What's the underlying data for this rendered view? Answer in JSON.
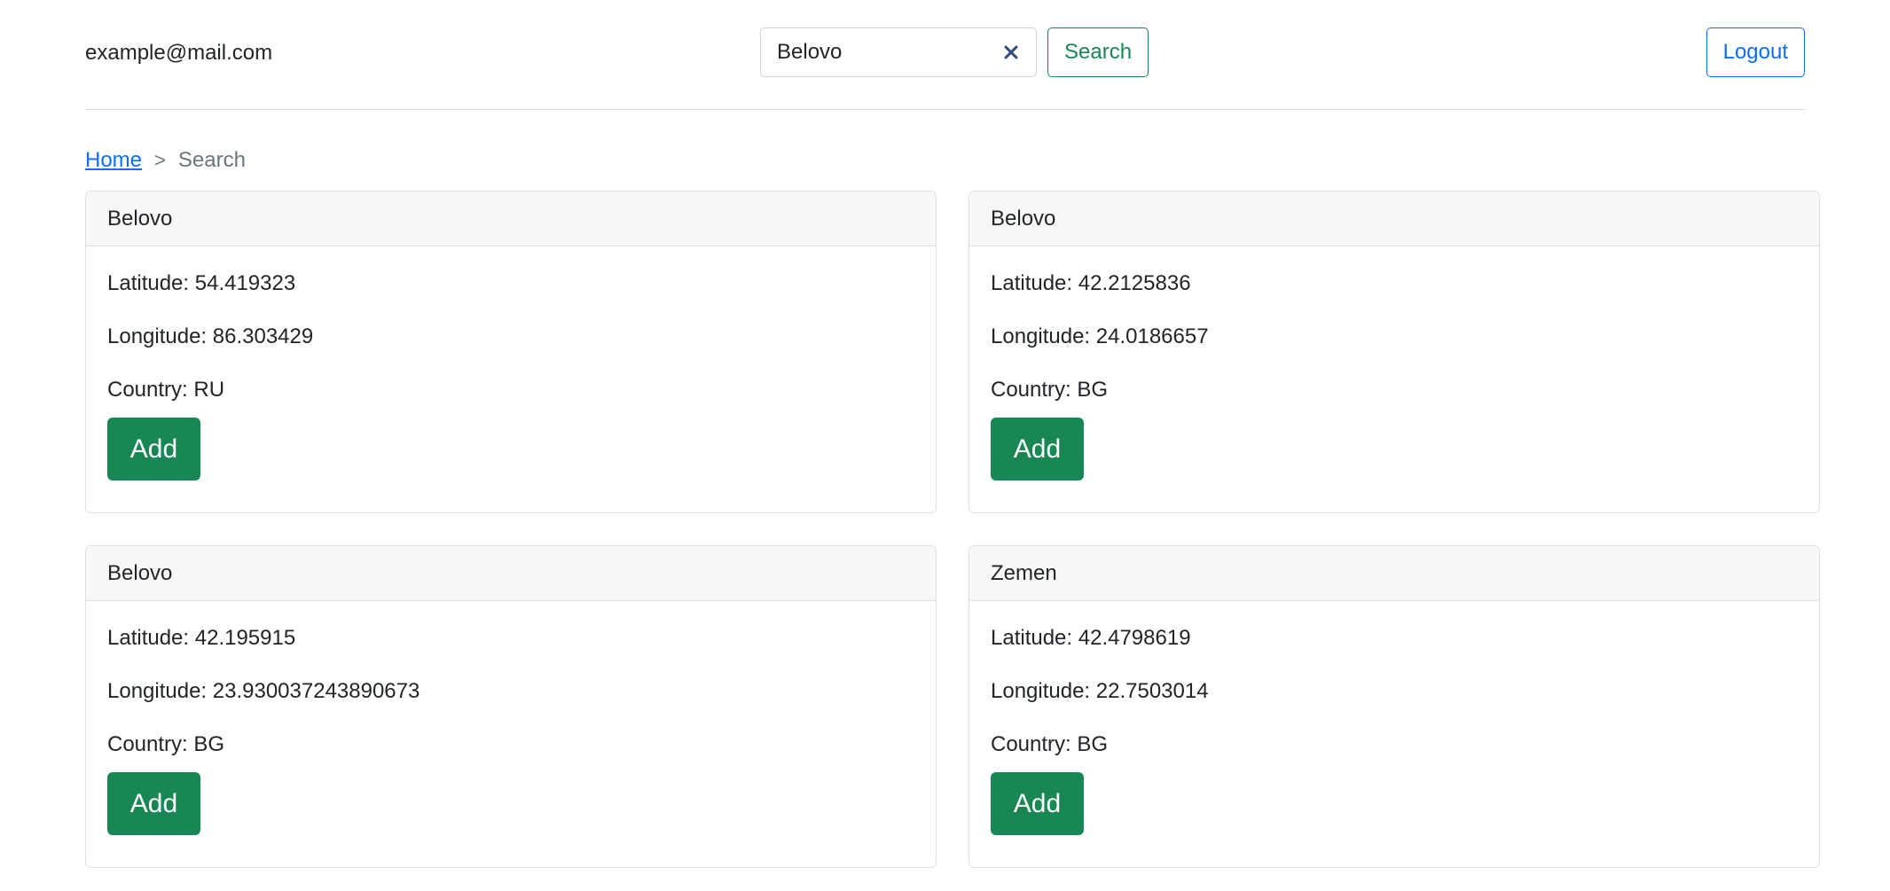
{
  "header": {
    "user_email": "example@mail.com",
    "search": {
      "value": "Belovo",
      "button_label": "Search"
    },
    "logout_label": "Logout"
  },
  "breadcrumb": {
    "home": "Home",
    "separator": ">",
    "current": "Search"
  },
  "results": [
    {
      "name": "Belovo",
      "latitude": "Latitude: 54.419323",
      "longitude": "Longitude: 86.303429",
      "country": "Country: RU",
      "add_label": "Add"
    },
    {
      "name": "Belovo",
      "latitude": "Latitude: 42.2125836",
      "longitude": "Longitude: 24.0186657",
      "country": "Country: BG",
      "add_label": "Add"
    },
    {
      "name": "Belovo",
      "latitude": "Latitude: 42.195915",
      "longitude": "Longitude: 23.930037243890673",
      "country": "Country: BG",
      "add_label": "Add"
    },
    {
      "name": "Zemen",
      "latitude": "Latitude: 42.4798619",
      "longitude": "Longitude: 22.7503014",
      "country": "Country: BG",
      "add_label": "Add"
    }
  ],
  "icons": {
    "clear": "close-icon"
  },
  "colors": {
    "primary": "#0d6efd",
    "success": "#198754",
    "clear_icon": "#2f4b7c"
  }
}
